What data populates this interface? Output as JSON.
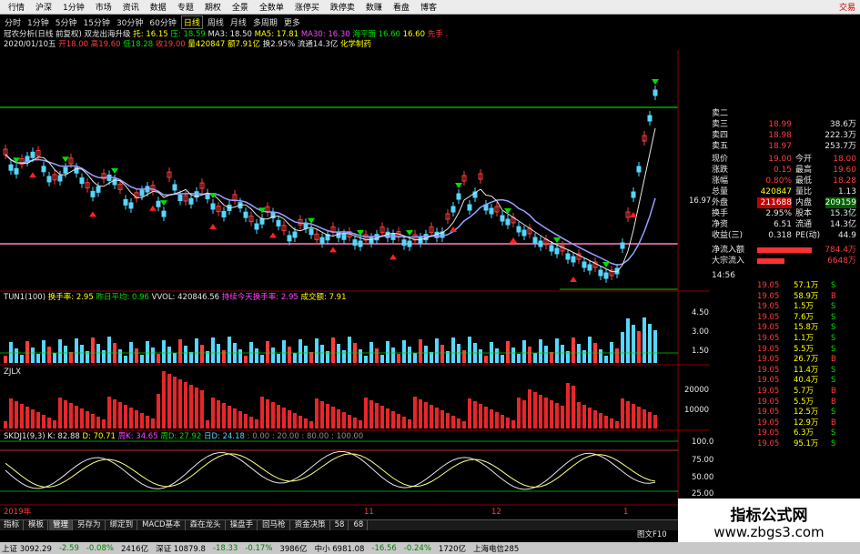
{
  "menubar": {
    "items": [
      "行情",
      "沪深",
      "1分钟",
      "市场",
      "资讯",
      "数据",
      "专题",
      "期权",
      "全景",
      "全数单",
      "涨停买",
      "跌停卖",
      "数赚",
      "看盘",
      "博客"
    ],
    "right": "交易"
  },
  "periods": {
    "items": [
      "分时",
      "1分钟",
      "5分钟",
      "15分钟",
      "30分钟",
      "60分钟",
      "日线",
      "周线",
      "月线",
      "多周期",
      "更多"
    ],
    "active": "日线"
  },
  "main_info": {
    "stock": "冠农分析(日线 前复权)",
    "indicator": "双龙出海升级",
    "ma1": "托: 16.15",
    "ma2": "压: 18.59",
    "ma3": "MA3: 18.50",
    "ma5": "MA5: 17.81",
    "ma30": "MA30: 16.30",
    "line2": "海平面 16.60",
    "line3": "16.60",
    "tag": "先手 .",
    "date": "2020/01/10五",
    "open": "开18.00",
    "high": "高19.60",
    "low": "低18.28",
    "close": "收19.00",
    "vol": "量420847",
    "amt": "额7.91亿",
    "turn": "换2.95%",
    "float": "流通14.3亿",
    "sector": "化学制药"
  },
  "price_axis": [
    "16.97"
  ],
  "sub1": {
    "name": "TUN1(100)",
    "a": "换手率: 2.95",
    "b": "昨日平均: 0.96",
    "c": "VVOL: 420846.56",
    "d": "持续今天换手率: 2.95",
    "e": "成交额: 7.91",
    "axis": [
      "4.50",
      "3.00",
      "1.50"
    ]
  },
  "sub2": {
    "name": "ZJLX",
    "axis": [
      "20000",
      "10000"
    ]
  },
  "sub3": {
    "name": "SKDJ1(9,3)",
    "k": "K: 82.88",
    "d": "D: 70.71",
    "rk": "周K: 34.65",
    "rd": "周D: 27.92",
    "dk": "日D: 24.18",
    "lv": ": 0.00 : 20.00 : 80.00 : 100.00",
    "axis": [
      "100.0",
      "75.00",
      "50.00",
      "25.00"
    ]
  },
  "date_axis": [
    "2019年",
    "11",
    "12",
    "1"
  ],
  "quote": {
    "sells": [
      {
        "label": "卖二",
        "price": "",
        "vol": ""
      },
      {
        "label": "卖三",
        "price": "18.99",
        "vol": "38.6万"
      },
      {
        "label": "卖四",
        "price": "18.98",
        "vol": "222.3万"
      },
      {
        "label": "卖五",
        "price": "18.97",
        "vol": "253.7万"
      }
    ],
    "stats": [
      {
        "a": "现价",
        "b": "19.00",
        "c": "今开",
        "d": "18.00"
      },
      {
        "a": "涨跌",
        "b": "0.15",
        "c": "最高",
        "d": "19.60"
      },
      {
        "a": "涨幅",
        "b": "0.80%",
        "c": "最低",
        "d": "18.28"
      },
      {
        "a": "总量",
        "b": "420847",
        "c": "量比",
        "d": "1.13"
      },
      {
        "a": "外盘",
        "b": "211688",
        "c": "内盘",
        "d": "209159"
      },
      {
        "a": "换手",
        "b": "2.95%",
        "c": "股本",
        "d": "15.3亿"
      },
      {
        "a": "净资",
        "b": "6.51",
        "c": "流通",
        "d": "14.3亿"
      },
      {
        "a": "收益(三)",
        "b": "0.318",
        "c": "PE(动)",
        "d": "44.9"
      }
    ],
    "flow": [
      {
        "label": "净流入额",
        "value": "784.4万"
      },
      {
        "label": "大宗流入",
        "value": "6648万"
      }
    ],
    "time": "14:56",
    "ticks": [
      {
        "p": "19.05",
        "v": "57.1万",
        "s": "S"
      },
      {
        "p": "19.05",
        "v": "58.9万",
        "s": "B"
      },
      {
        "p": "19.05",
        "v": "1.5万",
        "s": "S"
      },
      {
        "p": "19.05",
        "v": "7.6万",
        "s": "S"
      },
      {
        "p": "19.05",
        "v": "15.8万",
        "s": "S"
      },
      {
        "p": "19.05",
        "v": "1.1万",
        "s": "S"
      },
      {
        "p": "19.05",
        "v": "5.5万",
        "s": "S"
      },
      {
        "p": "19.05",
        "v": "26.7万",
        "s": "B"
      },
      {
        "p": "19.05",
        "v": "11.4万",
        "s": "S"
      },
      {
        "p": "19.05",
        "v": "40.4万",
        "s": "S"
      },
      {
        "p": "19.05",
        "v": "5.7万",
        "s": "B"
      },
      {
        "p": "19.05",
        "v": "5.5万",
        "s": "B"
      },
      {
        "p": "19.05",
        "v": "12.5万",
        "s": "S"
      },
      {
        "p": "19.05",
        "v": "12.9万",
        "s": "B"
      },
      {
        "p": "19.05",
        "v": "6.3万",
        "s": "S"
      },
      {
        "p": "19.05",
        "v": "95.1万",
        "s": "S"
      }
    ]
  },
  "funcbar": {
    "items": [
      "指标",
      "模板",
      "管理",
      "另存为",
      "绑定到",
      "MACD基本",
      "森在龙头",
      "操盘手",
      "回马枪",
      "资金决策",
      "58",
      "68"
    ],
    "selected": "管理"
  },
  "statusbar": {
    "sh": "上证 3092.29",
    "sh_chg": "-2.59",
    "sh_pct": "-0.08%",
    "sh_amt": "2416亿",
    "sz": "深证 10879.8",
    "sz_chg": "-18.33",
    "sz_pct": "-0.17%",
    "sz_amt": "3986亿",
    "zx": "中小 6981.08",
    "zx_chg": "-16.56",
    "zx_pct": "-0.24%",
    "zx_amt": "1720亿",
    "srv": "上海电信285"
  },
  "watermark": {
    "title": "指标公式网",
    "url": "www.zbgs3.com"
  },
  "misc": {
    "sidebar_tab": "图文F10"
  },
  "colors": {
    "up": "#ff3c3c",
    "down": "#55d7ff",
    "ma": "#9aa0ff",
    "accent": "#ffff00",
    "bg": "#000000"
  }
}
